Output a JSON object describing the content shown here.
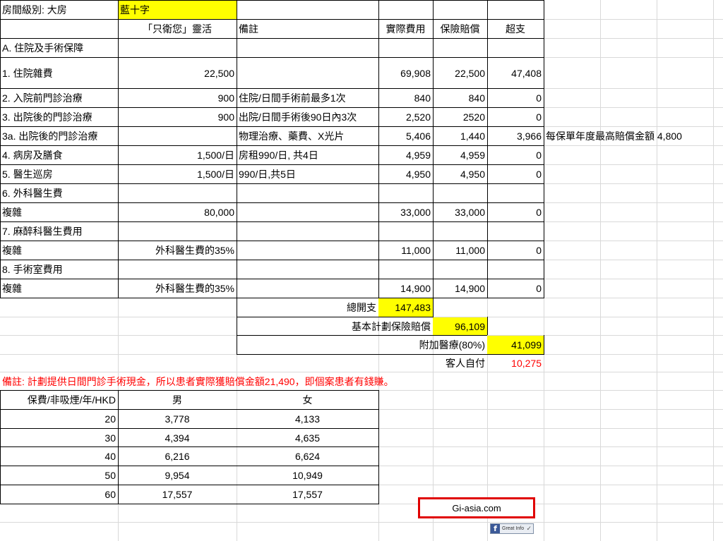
{
  "sheet": {
    "room_label": "房間級別: 大房",
    "plan_name": "藍十字",
    "headers": {
      "plan_col": "「只衛您」靈活",
      "remark": "備註",
      "actual": "實際費用",
      "claim": "保險賠償",
      "over": "超支"
    },
    "section_a": "A. 住院及手術保障",
    "rows": [
      {
        "item": "1. 住院雜費",
        "limit": "22,500",
        "remark": "",
        "actual": "69,908",
        "claim": "22,500",
        "over": "47,408",
        "note": ""
      },
      {
        "item": "2. 入院前門診治療",
        "limit": "900",
        "remark": "住院/日間手術前最多1次",
        "actual": "840",
        "claim": "840",
        "over": "0",
        "note": ""
      },
      {
        "item": "3. 出院後的門診治療",
        "limit": "900",
        "remark": "出院/日間手術後90日內3次",
        "actual": "2,520",
        "claim": "2520",
        "over": "0",
        "note": ""
      },
      {
        "item": "3a. 出院後的門診治療",
        "limit": "",
        "remark": "物理治療、藥費、X光片",
        "actual": "5,406",
        "claim": "1,440",
        "over": "3,966",
        "note": "每保單年度最高賠償金額 4,800"
      },
      {
        "item": "4. 病房及膳食",
        "limit": "1,500/日",
        "remark": "房租990/日, 共4日",
        "actual": "4,959",
        "claim": "4,959",
        "over": "0",
        "note": ""
      },
      {
        "item": "5. 醫生巡房",
        "limit": "1,500/日",
        "remark": "990/日,共5日",
        "actual": "4,950",
        "claim": "4,950",
        "over": "0",
        "note": ""
      },
      {
        "item": "6. 外科醫生費",
        "limit": "",
        "remark": "",
        "actual": "",
        "claim": "",
        "over": "",
        "note": ""
      },
      {
        "item": "複雜",
        "limit": "80,000",
        "remark": "",
        "actual": "33,000",
        "claim": "33,000",
        "over": "0",
        "note": ""
      },
      {
        "item": "7. 麻醉科醫生費用",
        "limit": "",
        "remark": "",
        "actual": "",
        "claim": "",
        "over": "",
        "note": ""
      },
      {
        "item": "複雜",
        "limit": "外科醫生費的35%",
        "remark": "",
        "actual": "11,000",
        "claim": "11,000",
        "over": "0",
        "note": ""
      },
      {
        "item": "8. 手術室費用",
        "limit": "",
        "remark": "",
        "actual": "",
        "claim": "",
        "over": "",
        "note": ""
      },
      {
        "item": "複雜",
        "limit": "外科醫生費的35%",
        "remark": "",
        "actual": "14,900",
        "claim": "14,900",
        "over": "0",
        "note": ""
      }
    ],
    "summary": {
      "total_label": "總開支",
      "total_value": "147,483",
      "basic_label": "基本計劃保險賠償",
      "basic_value": "96,109",
      "addon_label": "附加醫療(80%)",
      "addon_value": "41,099",
      "self_label": "客人自付",
      "self_value": "10,275"
    },
    "footnote": "備註: 計劃提供日間門診手術現金，所以患者實際獲賠償金額21,490，即個案患者有錢賺。",
    "premium": {
      "header": "保費/非吸煙/年/HKD",
      "male": "男",
      "female": "女",
      "rows": [
        {
          "age": "20",
          "male": "3,778",
          "female": "4,133"
        },
        {
          "age": "30",
          "male": "4,394",
          "female": "4,635"
        },
        {
          "age": "40",
          "male": "6,216",
          "female": "6,624"
        },
        {
          "age": "50",
          "male": "9,954",
          "female": "10,949"
        },
        {
          "age": "60",
          "male": "17,557",
          "female": "17,557"
        }
      ]
    },
    "watermark": "Gi-asia.com",
    "fb_badge": {
      "icon": "facebook-icon",
      "text": "Great Info",
      "mark": "✓"
    }
  }
}
